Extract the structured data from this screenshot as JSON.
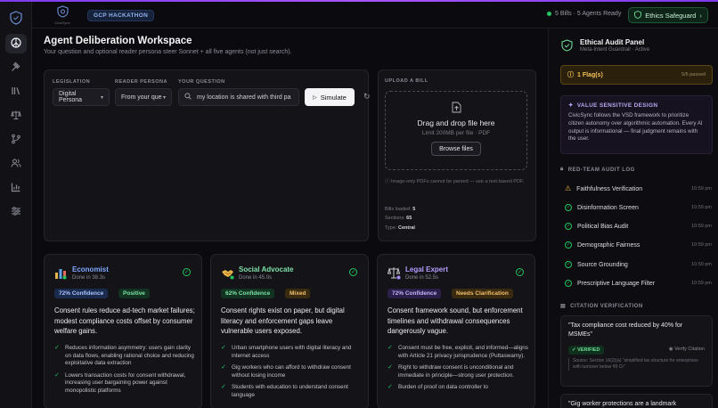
{
  "header": {
    "brand_small": "CivicSync",
    "badge": "GCP HACKATHON",
    "status": "5 Bills · 5 Agents Ready",
    "ethics_button": "Ethics Safeguard",
    "colors": {
      "accent": "#7c3aed",
      "ok": "#22c55e",
      "link": "#7ea6ff"
    }
  },
  "sidebar": {
    "items": [
      {
        "icon": "dashboard-icon"
      },
      {
        "icon": "gavel-icon"
      },
      {
        "icon": "library-icon"
      },
      {
        "icon": "scale-icon"
      },
      {
        "icon": "branch-icon"
      },
      {
        "icon": "users-icon"
      },
      {
        "icon": "bar-chart-icon"
      },
      {
        "icon": "sliders-icon"
      }
    ]
  },
  "main": {
    "title": "Agent Deliberation Workspace",
    "subtitle": "Your question and optional reader persona steer Sonnet + all five agents (not just search).",
    "legislation_label": "LEGISLATION",
    "legislation_value": "Digital Persona",
    "persona_label": "READER PERSONA",
    "persona_value": "From your que",
    "question_label": "YOUR QUESTION",
    "question_value": "my location is shared with third pa",
    "simulate": "Simulate"
  },
  "upload": {
    "label": "UPLOAD A BILL",
    "title": "Drag and drop file here",
    "limit": "Limit 200MB per file · PDF",
    "browse": "Browse files",
    "warning": "Image-only PDFs cannot be parsed — use a text-based PDF.",
    "bills_label": "Bills loaded:",
    "bills_value": "5",
    "sections_label": "Sections:",
    "sections_value": "65",
    "type_label": "Type:",
    "type_value": "Central"
  },
  "agents": [
    {
      "name": "Economist",
      "done": "Done in 38.3s",
      "confidence": "72% Confidence",
      "verdict": "Positive",
      "summary": "Consent rules reduce ad-tech market failures; modest compliance costs offset by consumer welfare gains.",
      "points": [
        "Reduces information asymmetry: users gain clarity on data flows, enabling rational choice and reducing exploitative data extraction",
        "Lowers transaction costs for consent withdrawal, increasing user bargaining power against monopolistic platforms"
      ]
    },
    {
      "name": "Social Advocate",
      "done": "Done in 45.0s",
      "confidence": "62% Confidence",
      "verdict": "Mixed",
      "summary": "Consent rights exist on paper, but digital literacy and enforcement gaps leave vulnerable users exposed.",
      "points": [
        "Urban smartphone users with digital literacy and internet access",
        "Gig workers who can afford to withdraw consent without losing income",
        "Students with education to understand consent language"
      ]
    },
    {
      "name": "Legal Expert",
      "done": "Done in 52.5s",
      "confidence": "72% Confidence",
      "verdict": "Needs Clarification",
      "summary": "Consent framework sound, but enforcement timelines and withdrawal consequences dangerously vague.",
      "points": [
        "Consent must be free, explicit, and informed—aligns with Article 21 privacy jurisprudence (Puttaswamy).",
        "Right to withdraw consent is unconditional and immediate in principle—strong user protection.",
        "Burden of proof on data controller to"
      ]
    }
  ],
  "audit_panel": {
    "title": "Ethical Audit Panel",
    "subtitle": "Meta-Intent Guardrail · Active",
    "flags": "1 Flag(s)",
    "passed": "5/6 passed",
    "vsd_title": "VALUE SENSITIVE DESIGN",
    "vsd_body": "CivicSync follows the VSD framework to prioritize citizen autonomy over algorithmic automation. Every AI output is informational — final judgment remains with the user.",
    "log_title": "RED-TEAM AUDIT LOG",
    "log": [
      {
        "name": "Faithfulness Verification",
        "time": "10:59 pm",
        "status": "warn"
      },
      {
        "name": "Disinformation Screen",
        "time": "10:59 pm",
        "status": "ok"
      },
      {
        "name": "Political Bias Audit",
        "time": "10:59 pm",
        "status": "ok"
      },
      {
        "name": "Demographic Fairness",
        "time": "10:59 pm",
        "status": "ok"
      },
      {
        "name": "Source Grounding",
        "time": "10:59 pm",
        "status": "ok"
      },
      {
        "name": "Prescriptive Language Filter",
        "time": "10:59 pm",
        "status": "ok"
      }
    ],
    "citation_title": "CITATION VERIFICATION",
    "citations": [
      {
        "quote": "\"Tax compliance cost reduced by 40% for MSMEs\"",
        "badge": "VERIFIED",
        "verify": "Verify Citation",
        "source": "Source: Section 16(2)(a) \"simplified tax structure for enterprises with turnover below ₹5 Cr\""
      },
      {
        "quote": "\"Gig worker protections are a landmark"
      }
    ]
  }
}
